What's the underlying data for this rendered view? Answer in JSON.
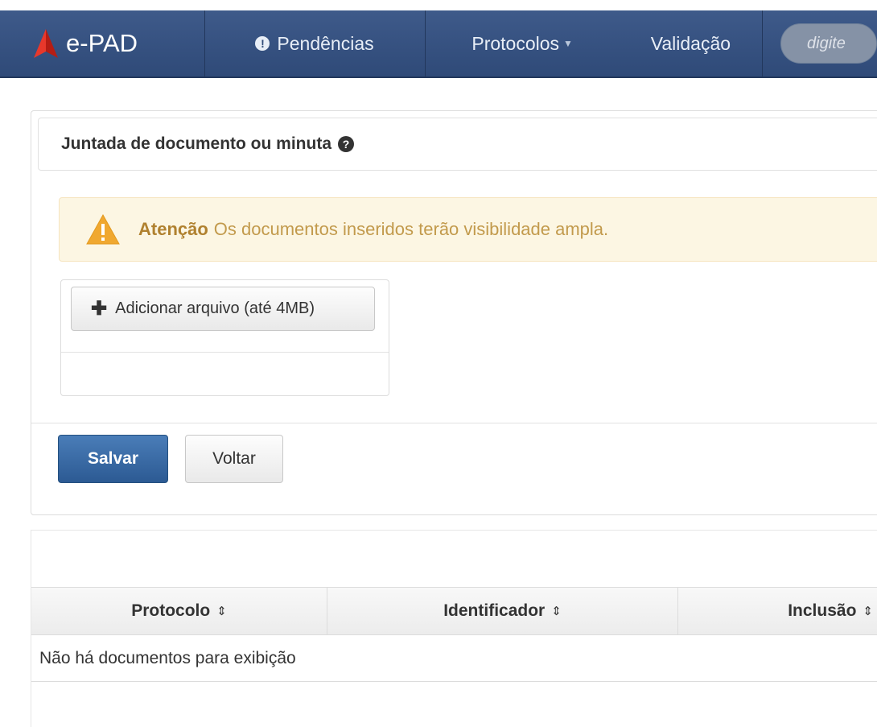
{
  "navbar": {
    "brand": "e-PAD",
    "items": [
      {
        "label": "Pendências",
        "icon": "exclamation-circle-icon"
      },
      {
        "label": "Protocolos",
        "icon": "caret-down-icon"
      },
      {
        "label": "Validação"
      }
    ],
    "search_placeholder": "digite"
  },
  "panel": {
    "title": "Juntada de documento ou minuta",
    "alert": {
      "strong": "Atenção",
      "text": "Os documentos inseridos terão visibilidade ampla."
    },
    "add_file_label": "Adicionar arquivo (até 4MB)",
    "save_label": "Salvar",
    "back_label": "Voltar"
  },
  "table": {
    "columns": [
      "Protocolo",
      "Identificador",
      "Inclusão"
    ],
    "empty_message": "Não há documentos para exibição"
  },
  "colors": {
    "navbar": "#2f4a78",
    "primary_button": "#2c5a93",
    "alert_bg": "#fcf6e3",
    "logo_red": "#d9261c"
  }
}
